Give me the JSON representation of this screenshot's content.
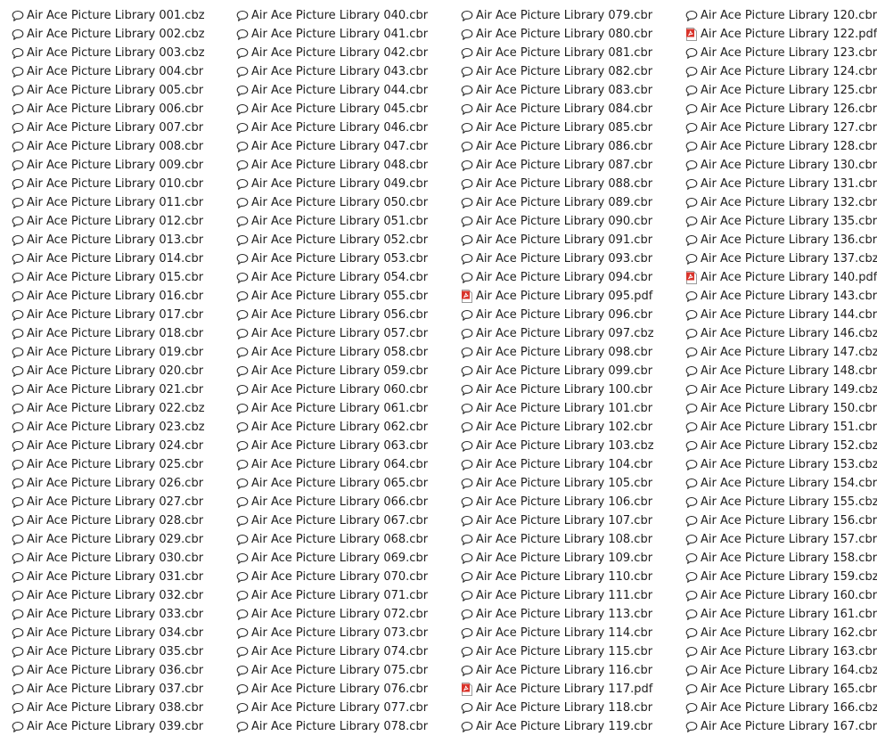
{
  "files": [
    {
      "name": "Air Ace Picture Library 001.cbz",
      "icon": "comment-icon"
    },
    {
      "name": "Air Ace Picture Library 002.cbz",
      "icon": "comment-icon"
    },
    {
      "name": "Air Ace Picture Library 003.cbz",
      "icon": "comment-icon"
    },
    {
      "name": "Air Ace Picture Library 004.cbr",
      "icon": "comment-icon"
    },
    {
      "name": "Air Ace Picture Library 005.cbr",
      "icon": "comment-icon"
    },
    {
      "name": "Air Ace Picture Library 006.cbr",
      "icon": "comment-icon"
    },
    {
      "name": "Air Ace Picture Library 007.cbr",
      "icon": "comment-icon"
    },
    {
      "name": "Air Ace Picture Library 008.cbr",
      "icon": "comment-icon"
    },
    {
      "name": "Air Ace Picture Library 009.cbr",
      "icon": "comment-icon"
    },
    {
      "name": "Air Ace Picture Library 010.cbr",
      "icon": "comment-icon"
    },
    {
      "name": "Air Ace Picture Library 011.cbr",
      "icon": "comment-icon"
    },
    {
      "name": "Air Ace Picture Library 012.cbr",
      "icon": "comment-icon"
    },
    {
      "name": "Air Ace Picture Library 013.cbr",
      "icon": "comment-icon"
    },
    {
      "name": "Air Ace Picture Library 014.cbr",
      "icon": "comment-icon"
    },
    {
      "name": "Air Ace Picture Library 015.cbr",
      "icon": "comment-icon"
    },
    {
      "name": "Air Ace Picture Library 016.cbr",
      "icon": "comment-icon"
    },
    {
      "name": "Air Ace Picture Library 017.cbr",
      "icon": "comment-icon"
    },
    {
      "name": "Air Ace Picture Library 018.cbr",
      "icon": "comment-icon"
    },
    {
      "name": "Air Ace Picture Library 019.cbr",
      "icon": "comment-icon"
    },
    {
      "name": "Air Ace Picture Library 020.cbr",
      "icon": "comment-icon"
    },
    {
      "name": "Air Ace Picture Library 021.cbr",
      "icon": "comment-icon"
    },
    {
      "name": "Air Ace Picture Library 022.cbz",
      "icon": "comment-icon"
    },
    {
      "name": "Air Ace Picture Library 023.cbz",
      "icon": "comment-icon"
    },
    {
      "name": "Air Ace Picture Library 024.cbr",
      "icon": "comment-icon"
    },
    {
      "name": "Air Ace Picture Library 025.cbr",
      "icon": "comment-icon"
    },
    {
      "name": "Air Ace Picture Library 026.cbr",
      "icon": "comment-icon"
    },
    {
      "name": "Air Ace Picture Library 027.cbr",
      "icon": "comment-icon"
    },
    {
      "name": "Air Ace Picture Library 028.cbr",
      "icon": "comment-icon"
    },
    {
      "name": "Air Ace Picture Library 029.cbr",
      "icon": "comment-icon"
    },
    {
      "name": "Air Ace Picture Library 030.cbr",
      "icon": "comment-icon"
    },
    {
      "name": "Air Ace Picture Library 031.cbr",
      "icon": "comment-icon"
    },
    {
      "name": "Air Ace Picture Library 032.cbr",
      "icon": "comment-icon"
    },
    {
      "name": "Air Ace Picture Library 033.cbr",
      "icon": "comment-icon"
    },
    {
      "name": "Air Ace Picture Library 034.cbr",
      "icon": "comment-icon"
    },
    {
      "name": "Air Ace Picture Library 035.cbr",
      "icon": "comment-icon"
    },
    {
      "name": "Air Ace Picture Library 036.cbr",
      "icon": "comment-icon"
    },
    {
      "name": "Air Ace Picture Library 037.cbr",
      "icon": "comment-icon"
    },
    {
      "name": "Air Ace Picture Library 038.cbr",
      "icon": "comment-icon"
    },
    {
      "name": "Air Ace Picture Library 039.cbr",
      "icon": "comment-icon"
    },
    {
      "name": "Air Ace Picture Library 040.cbr",
      "icon": "comment-icon"
    },
    {
      "name": "Air Ace Picture Library 041.cbr",
      "icon": "comment-icon"
    },
    {
      "name": "Air Ace Picture Library 042.cbr",
      "icon": "comment-icon"
    },
    {
      "name": "Air Ace Picture Library 043.cbr",
      "icon": "comment-icon"
    },
    {
      "name": "Air Ace Picture Library 044.cbr",
      "icon": "comment-icon"
    },
    {
      "name": "Air Ace Picture Library 045.cbr",
      "icon": "comment-icon"
    },
    {
      "name": "Air Ace Picture Library 046.cbr",
      "icon": "comment-icon"
    },
    {
      "name": "Air Ace Picture Library 047.cbr",
      "icon": "comment-icon"
    },
    {
      "name": "Air Ace Picture Library 048.cbr",
      "icon": "comment-icon"
    },
    {
      "name": "Air Ace Picture Library 049.cbr",
      "icon": "comment-icon"
    },
    {
      "name": "Air Ace Picture Library 050.cbr",
      "icon": "comment-icon"
    },
    {
      "name": "Air Ace Picture Library 051.cbr",
      "icon": "comment-icon"
    },
    {
      "name": "Air Ace Picture Library 052.cbr",
      "icon": "comment-icon"
    },
    {
      "name": "Air Ace Picture Library 053.cbr",
      "icon": "comment-icon"
    },
    {
      "name": "Air Ace Picture Library 054.cbr",
      "icon": "comment-icon"
    },
    {
      "name": "Air Ace Picture Library 055.cbr",
      "icon": "comment-icon"
    },
    {
      "name": "Air Ace Picture Library 056.cbr",
      "icon": "comment-icon"
    },
    {
      "name": "Air Ace Picture Library 057.cbr",
      "icon": "comment-icon"
    },
    {
      "name": "Air Ace Picture Library 058.cbr",
      "icon": "comment-icon"
    },
    {
      "name": "Air Ace Picture Library 059.cbr",
      "icon": "comment-icon"
    },
    {
      "name": "Air Ace Picture Library 060.cbr",
      "icon": "comment-icon"
    },
    {
      "name": "Air Ace Picture Library 061.cbr",
      "icon": "comment-icon"
    },
    {
      "name": "Air Ace Picture Library 062.cbr",
      "icon": "comment-icon"
    },
    {
      "name": "Air Ace Picture Library 063.cbr",
      "icon": "comment-icon"
    },
    {
      "name": "Air Ace Picture Library 064.cbr",
      "icon": "comment-icon"
    },
    {
      "name": "Air Ace Picture Library 065.cbr",
      "icon": "comment-icon"
    },
    {
      "name": "Air Ace Picture Library 066.cbr",
      "icon": "comment-icon"
    },
    {
      "name": "Air Ace Picture Library 067.cbr",
      "icon": "comment-icon"
    },
    {
      "name": "Air Ace Picture Library 068.cbr",
      "icon": "comment-icon"
    },
    {
      "name": "Air Ace Picture Library 069.cbr",
      "icon": "comment-icon"
    },
    {
      "name": "Air Ace Picture Library 070.cbr",
      "icon": "comment-icon"
    },
    {
      "name": "Air Ace Picture Library 071.cbr",
      "icon": "comment-icon"
    },
    {
      "name": "Air Ace Picture Library 072.cbr",
      "icon": "comment-icon"
    },
    {
      "name": "Air Ace Picture Library 073.cbr",
      "icon": "comment-icon"
    },
    {
      "name": "Air Ace Picture Library 074.cbr",
      "icon": "comment-icon"
    },
    {
      "name": "Air Ace Picture Library 075.cbr",
      "icon": "comment-icon"
    },
    {
      "name": "Air Ace Picture Library 076.cbr",
      "icon": "comment-icon"
    },
    {
      "name": "Air Ace Picture Library 077.cbr",
      "icon": "comment-icon"
    },
    {
      "name": "Air Ace Picture Library 078.cbr",
      "icon": "comment-icon"
    },
    {
      "name": "Air Ace Picture Library 079.cbr",
      "icon": "comment-icon"
    },
    {
      "name": "Air Ace Picture Library 080.cbr",
      "icon": "comment-icon"
    },
    {
      "name": "Air Ace Picture Library 081.cbr",
      "icon": "comment-icon"
    },
    {
      "name": "Air Ace Picture Library 082.cbr",
      "icon": "comment-icon"
    },
    {
      "name": "Air Ace Picture Library 083.cbr",
      "icon": "comment-icon"
    },
    {
      "name": "Air Ace Picture Library 084.cbr",
      "icon": "comment-icon"
    },
    {
      "name": "Air Ace Picture Library 085.cbr",
      "icon": "comment-icon"
    },
    {
      "name": "Air Ace Picture Library 086.cbr",
      "icon": "comment-icon"
    },
    {
      "name": "Air Ace Picture Library 087.cbr",
      "icon": "comment-icon"
    },
    {
      "name": "Air Ace Picture Library 088.cbr",
      "icon": "comment-icon"
    },
    {
      "name": "Air Ace Picture Library 089.cbr",
      "icon": "comment-icon"
    },
    {
      "name": "Air Ace Picture Library 090.cbr",
      "icon": "comment-icon"
    },
    {
      "name": "Air Ace Picture Library 091.cbr",
      "icon": "comment-icon"
    },
    {
      "name": "Air Ace Picture Library 093.cbr",
      "icon": "comment-icon"
    },
    {
      "name": "Air Ace Picture Library 094.cbr",
      "icon": "comment-icon"
    },
    {
      "name": "Air Ace Picture Library 095.pdf",
      "icon": "pdf-icon"
    },
    {
      "name": "Air Ace Picture Library 096.cbr",
      "icon": "comment-icon"
    },
    {
      "name": "Air Ace Picture Library 097.cbz",
      "icon": "comment-icon"
    },
    {
      "name": "Air Ace Picture Library 098.cbr",
      "icon": "comment-icon"
    },
    {
      "name": "Air Ace Picture Library 099.cbr",
      "icon": "comment-icon"
    },
    {
      "name": "Air Ace Picture Library 100.cbr",
      "icon": "comment-icon"
    },
    {
      "name": "Air Ace Picture Library 101.cbr",
      "icon": "comment-icon"
    },
    {
      "name": "Air Ace Picture Library 102.cbr",
      "icon": "comment-icon"
    },
    {
      "name": "Air Ace Picture Library 103.cbz",
      "icon": "comment-icon"
    },
    {
      "name": "Air Ace Picture Library 104.cbr",
      "icon": "comment-icon"
    },
    {
      "name": "Air Ace Picture Library 105.cbr",
      "icon": "comment-icon"
    },
    {
      "name": "Air Ace Picture Library 106.cbr",
      "icon": "comment-icon"
    },
    {
      "name": "Air Ace Picture Library 107.cbr",
      "icon": "comment-icon"
    },
    {
      "name": "Air Ace Picture Library 108.cbr",
      "icon": "comment-icon"
    },
    {
      "name": "Air Ace Picture Library 109.cbr",
      "icon": "comment-icon"
    },
    {
      "name": "Air Ace Picture Library 110.cbr",
      "icon": "comment-icon"
    },
    {
      "name": "Air Ace Picture Library 111.cbr",
      "icon": "comment-icon"
    },
    {
      "name": "Air Ace Picture Library 113.cbr",
      "icon": "comment-icon"
    },
    {
      "name": "Air Ace Picture Library 114.cbr",
      "icon": "comment-icon"
    },
    {
      "name": "Air Ace Picture Library 115.cbr",
      "icon": "comment-icon"
    },
    {
      "name": "Air Ace Picture Library 116.cbr",
      "icon": "comment-icon"
    },
    {
      "name": "Air Ace Picture Library 117.pdf",
      "icon": "pdf-icon"
    },
    {
      "name": "Air Ace Picture Library 118.cbr",
      "icon": "comment-icon"
    },
    {
      "name": "Air Ace Picture Library 119.cbr",
      "icon": "comment-icon"
    },
    {
      "name": "Air Ace Picture Library 120.cbr",
      "icon": "comment-icon"
    },
    {
      "name": "Air Ace Picture Library 122.pdf",
      "icon": "pdf-icon"
    },
    {
      "name": "Air Ace Picture Library 123.cbr",
      "icon": "comment-icon"
    },
    {
      "name": "Air Ace Picture Library 124.cbr",
      "icon": "comment-icon"
    },
    {
      "name": "Air Ace Picture Library 125.cbr",
      "icon": "comment-icon"
    },
    {
      "name": "Air Ace Picture Library 126.cbr",
      "icon": "comment-icon"
    },
    {
      "name": "Air Ace Picture Library 127.cbr",
      "icon": "comment-icon"
    },
    {
      "name": "Air Ace Picture Library 128.cbr",
      "icon": "comment-icon"
    },
    {
      "name": "Air Ace Picture Library 130.cbr",
      "icon": "comment-icon"
    },
    {
      "name": "Air Ace Picture Library 131.cbr",
      "icon": "comment-icon"
    },
    {
      "name": "Air Ace Picture Library 132.cbr",
      "icon": "comment-icon"
    },
    {
      "name": "Air Ace Picture Library 135.cbr",
      "icon": "comment-icon"
    },
    {
      "name": "Air Ace Picture Library 136.cbr",
      "icon": "comment-icon"
    },
    {
      "name": "Air Ace Picture Library 137.cbz",
      "icon": "comment-icon"
    },
    {
      "name": "Air Ace Picture Library 140.pdf",
      "icon": "pdf-icon"
    },
    {
      "name": "Air Ace Picture Library 143.cbr",
      "icon": "comment-icon"
    },
    {
      "name": "Air Ace Picture Library 144.cbr",
      "icon": "comment-icon"
    },
    {
      "name": "Air Ace Picture Library 146.cbz",
      "icon": "comment-icon"
    },
    {
      "name": "Air Ace Picture Library 147.cbz",
      "icon": "comment-icon"
    },
    {
      "name": "Air Ace Picture Library 148.cbr",
      "icon": "comment-icon"
    },
    {
      "name": "Air Ace Picture Library 149.cbz",
      "icon": "comment-icon"
    },
    {
      "name": "Air Ace Picture Library 150.cbr",
      "icon": "comment-icon"
    },
    {
      "name": "Air Ace Picture Library 151.cbr",
      "icon": "comment-icon"
    },
    {
      "name": "Air Ace Picture Library 152.cbz",
      "icon": "comment-icon"
    },
    {
      "name": "Air Ace Picture Library 153.cbz",
      "icon": "comment-icon"
    },
    {
      "name": "Air Ace Picture Library 154.cbr",
      "icon": "comment-icon"
    },
    {
      "name": "Air Ace Picture Library 155.cbz",
      "icon": "comment-icon"
    },
    {
      "name": "Air Ace Picture Library 156.cbr",
      "icon": "comment-icon"
    },
    {
      "name": "Air Ace Picture Library 157.cbr",
      "icon": "comment-icon"
    },
    {
      "name": "Air Ace Picture Library 158.cbr",
      "icon": "comment-icon"
    },
    {
      "name": "Air Ace Picture Library 159.cbz",
      "icon": "comment-icon"
    },
    {
      "name": "Air Ace Picture Library 160.cbr",
      "icon": "comment-icon"
    },
    {
      "name": "Air Ace Picture Library 161.cbr",
      "icon": "comment-icon"
    },
    {
      "name": "Air Ace Picture Library 162.cbr",
      "icon": "comment-icon"
    },
    {
      "name": "Air Ace Picture Library 163.cbr",
      "icon": "comment-icon"
    },
    {
      "name": "Air Ace Picture Library 164.cbz",
      "icon": "comment-icon"
    },
    {
      "name": "Air Ace Picture Library 165.cbr",
      "icon": "comment-icon"
    },
    {
      "name": "Air Ace Picture Library 166.cbz",
      "icon": "comment-icon"
    },
    {
      "name": "Air Ace Picture Library 167.cbr",
      "icon": "comment-icon"
    }
  ],
  "colors": {
    "text": "#1e1e1e",
    "icon_stroke": "#2b2b2b",
    "pdf_red": "#d9342b",
    "background": "#ffffff"
  }
}
